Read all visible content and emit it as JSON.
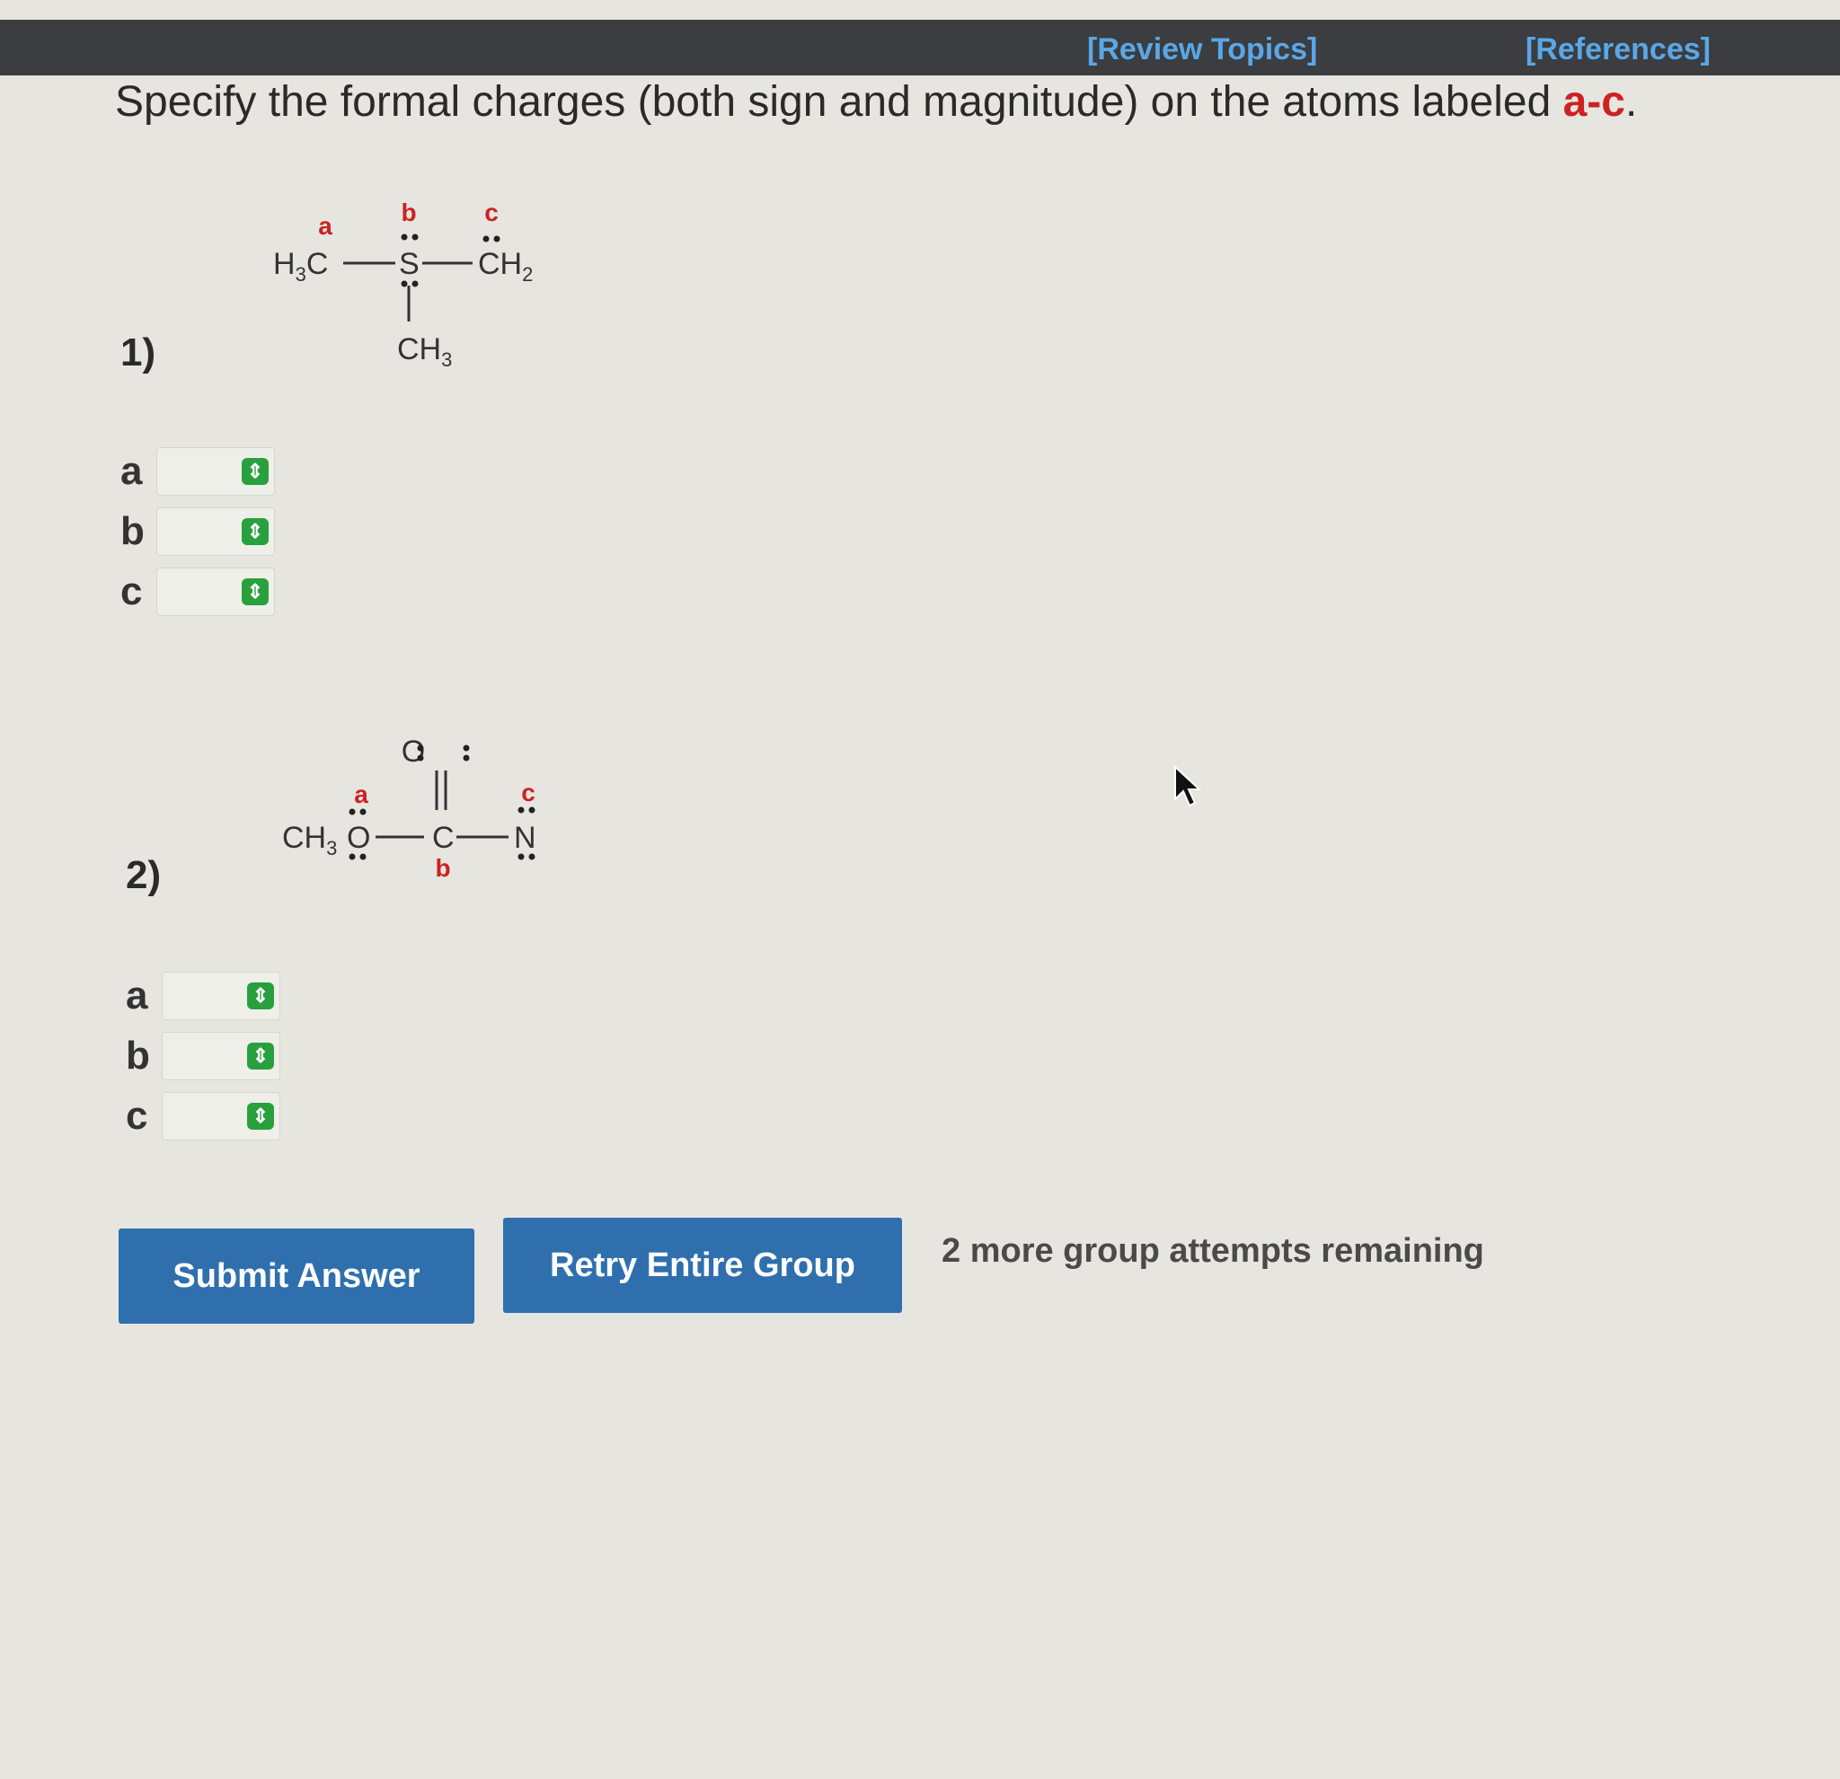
{
  "header": {
    "review_topics": "[Review Topics]",
    "references": "[References]"
  },
  "question": {
    "text": "Specify the formal charges (both sign and magnitude) on the atoms labeled ",
    "highlight": "a-c",
    "end": "."
  },
  "problems": [
    {
      "number": "1)",
      "molecule": {
        "h3c": "H",
        "h3c_sub": "3",
        "h3c_c": "C",
        "s": "S",
        "ch2": "CH",
        "ch2_sub": "2",
        "ch3": "CH",
        "ch3_sub": "3",
        "label_a": "a",
        "label_b": "b",
        "label_c": "c"
      },
      "rows": [
        {
          "label": "a",
          "value": ""
        },
        {
          "label": "b",
          "value": ""
        },
        {
          "label": "c",
          "value": ""
        }
      ]
    },
    {
      "number": "2)",
      "molecule": {
        "ch3": "CH",
        "ch3_sub": "3",
        "o_single": "O",
        "o_double": "O",
        "c": "C",
        "n": "N",
        "label_a": "a",
        "label_b": "b",
        "label_c": "c"
      },
      "rows": [
        {
          "label": "a",
          "value": ""
        },
        {
          "label": "b",
          "value": ""
        },
        {
          "label": "c",
          "value": ""
        }
      ]
    }
  ],
  "buttons": {
    "submit": "Submit Answer",
    "retry": "Retry Entire Group"
  },
  "attempts_text": "2 more group attempts remaining",
  "colors": {
    "accent_blue": "#2f6fae",
    "spinner_green": "#29a03e",
    "label_red": "#cc2222",
    "link_blue": "#5aa7e6"
  }
}
